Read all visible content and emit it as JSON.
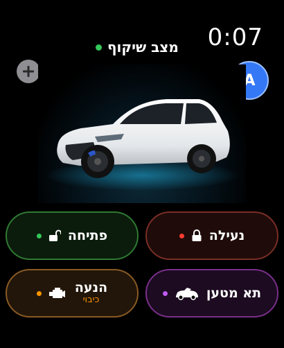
{
  "status": {
    "time": "0:07",
    "mode_label": "מצב שיקוף",
    "mode_dot_color": "#34c759"
  },
  "header": {
    "add_icon": "plus-icon",
    "avatar_letter": "A",
    "avatar_color": "#3478f6"
  },
  "vehicle": {
    "image": "white-hatchback-car"
  },
  "controls": {
    "lock": {
      "label": "נעילה",
      "icon": "lock-icon",
      "dot_color": "#ff3b30"
    },
    "unlock": {
      "label": "פתיחה",
      "icon": "unlock-icon",
      "dot_color": "#34c759"
    },
    "trunk": {
      "label": "תא מטען",
      "icon": "car-trunk-icon",
      "dot_color": "#bf5af2"
    },
    "engine": {
      "label": "הנעה",
      "sublabel": "כיבוי",
      "icon": "engine-icon",
      "dot_color": "#ff9500"
    }
  }
}
